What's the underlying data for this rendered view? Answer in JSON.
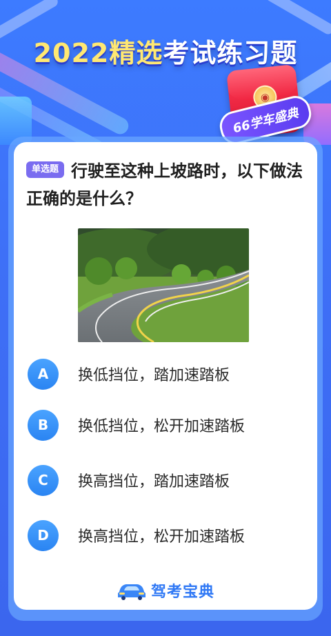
{
  "header": {
    "title_highlight": "2022精选",
    "title_rest": "考试练习题"
  },
  "badge": {
    "ribbon_text": "66学车盛典",
    "coin_icon": "car-icon"
  },
  "question": {
    "tag": "单选题",
    "text": "行驶至这种上坡路时，以下做法正确的是什么？",
    "image": "winding-road-photo"
  },
  "options": [
    {
      "letter": "A",
      "text": "换低挡位，踏加速踏板"
    },
    {
      "letter": "B",
      "text": "换低挡位，松开加速踏板"
    },
    {
      "letter": "C",
      "text": "换高挡位，踏加速踏板"
    },
    {
      "letter": "D",
      "text": "换高挡位，松开加速踏板"
    }
  ],
  "brand": {
    "name": "驾考宝典",
    "logo_icon": "car-logo-icon"
  },
  "colors": {
    "background": "#3d7bff",
    "option_circle": "#3b94fa",
    "brand": "#2f78f5",
    "tag": "#7a6cf0"
  }
}
